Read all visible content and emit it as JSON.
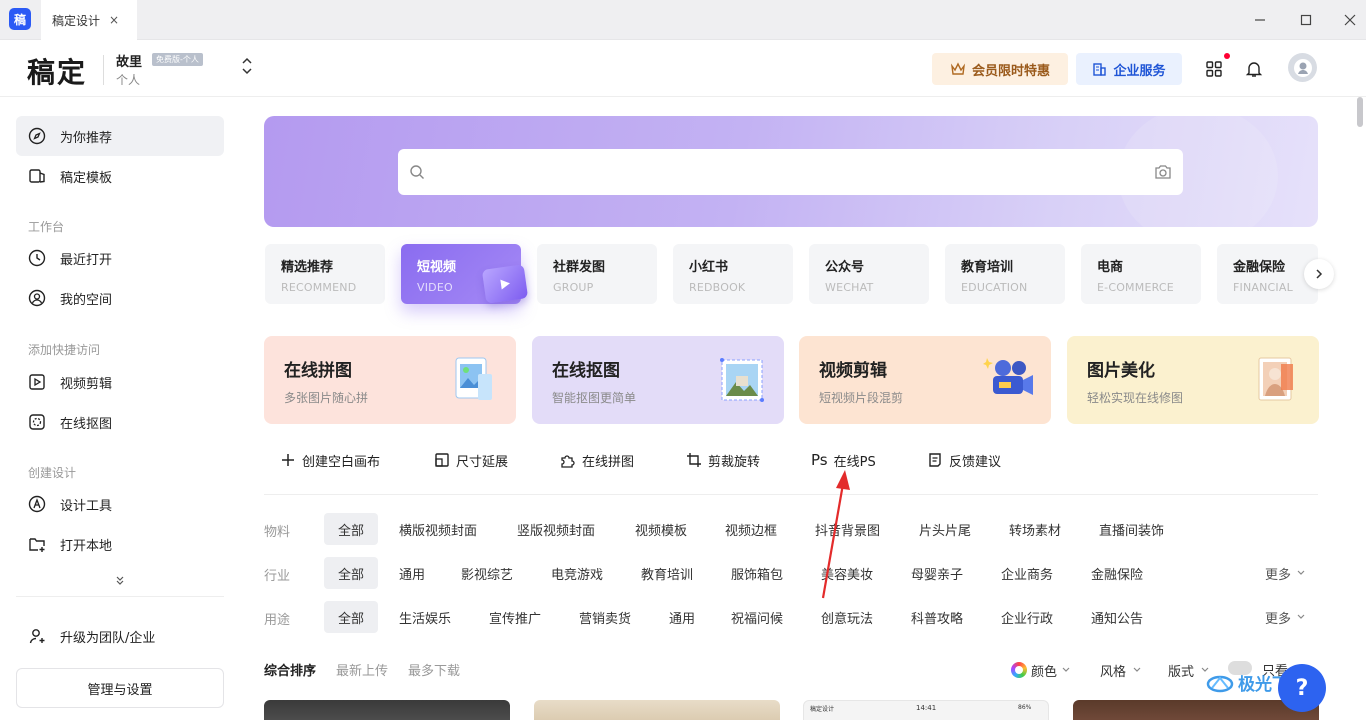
{
  "window": {
    "app_icon_text": "稿",
    "tab_title": "稿定设计",
    "tab_close": "×",
    "minimize": "—",
    "maximize": "☐",
    "close": "✕"
  },
  "header": {
    "logo": "稿定",
    "user_name": "故里",
    "user_badge": "免费版-个人",
    "user_sub": "个人",
    "vip_button": "会员限时特惠",
    "enterprise_button": "企业服务"
  },
  "sidebar": {
    "main_items": [
      {
        "label": "为你推荐",
        "icon": "compass-icon"
      },
      {
        "label": "稿定模板",
        "icon": "template-icon"
      }
    ],
    "workspace_title": "工作台",
    "workspace_items": [
      {
        "label": "最近打开",
        "icon": "clock-icon"
      },
      {
        "label": "我的空间",
        "icon": "user-circle-icon"
      }
    ],
    "quick_title": "添加快捷访问",
    "quick_items": [
      {
        "label": "视频剪辑",
        "icon": "play-square-icon"
      },
      {
        "label": "在线抠图",
        "icon": "cutout-icon"
      }
    ],
    "create_title": "创建设计",
    "create_items": [
      {
        "label": "设计工具",
        "icon": "pen-tool-icon"
      },
      {
        "label": "打开本地",
        "icon": "folder-plus-icon"
      }
    ],
    "upgrade": "升级为团队/企业",
    "manage": "管理与设置"
  },
  "search": {
    "placeholder": ""
  },
  "categories": [
    {
      "title": "精选推荐",
      "sub": "RECOMMEND"
    },
    {
      "title": "短视频",
      "sub": "VIDEO"
    },
    {
      "title": "社群发图",
      "sub": "GROUP"
    },
    {
      "title": "小红书",
      "sub": "REDBOOK"
    },
    {
      "title": "公众号",
      "sub": "WECHAT"
    },
    {
      "title": "教育培训",
      "sub": "EDUCATION"
    },
    {
      "title": "电商",
      "sub": "E-COMMERCE"
    },
    {
      "title": "金融保险",
      "sub": "FINANCIAL"
    }
  ],
  "feature_cards": [
    {
      "title": "在线拼图",
      "sub": "多张图片随心拼",
      "bg": "#fde3dc"
    },
    {
      "title": "在线抠图",
      "sub": "智能抠图更简单",
      "bg": "#e3dcf8"
    },
    {
      "title": "视频剪辑",
      "sub": "短视频片段混剪",
      "bg": "#fde4d2"
    },
    {
      "title": "图片美化",
      "sub": "轻松实现在线修图",
      "bg": "#fbf1cf"
    }
  ],
  "tools": [
    {
      "label": "创建空白画布",
      "icon": "plus-icon"
    },
    {
      "label": "尺寸延展",
      "icon": "resize-icon"
    },
    {
      "label": "在线拼图",
      "icon": "puzzle-icon"
    },
    {
      "label": "剪裁旋转",
      "icon": "crop-icon"
    },
    {
      "label": "在线PS",
      "icon": "ps-icon",
      "icon_text": "Ps"
    },
    {
      "label": "反馈建议",
      "icon": "feedback-icon"
    }
  ],
  "filters": {
    "material": {
      "label": "物料",
      "items": [
        "全部",
        "横版视频封面",
        "竖版视频封面",
        "视频模板",
        "视频边框",
        "抖音背景图",
        "片头片尾",
        "转场素材",
        "直播间装饰"
      ]
    },
    "industry": {
      "label": "行业",
      "items": [
        "全部",
        "通用",
        "影视综艺",
        "电竞游戏",
        "教育培训",
        "服饰箱包",
        "美容美妆",
        "母婴亲子",
        "企业商务",
        "金融保险"
      ],
      "more": "更多"
    },
    "usage": {
      "label": "用途",
      "items": [
        "全部",
        "生活娱乐",
        "宣传推广",
        "营销卖货",
        "通用",
        "祝福问候",
        "创意玩法",
        "科普攻略",
        "企业行政",
        "通知公告"
      ],
      "more": "更多"
    }
  },
  "sort": {
    "tabs": [
      "综合排序",
      "最新上传",
      "最多下载"
    ],
    "color": "颜色",
    "style": "风格",
    "layout": "版式",
    "partial": "只看"
  },
  "preview_text": {
    "phone_left": "稿定设计",
    "phone_time": "14:41",
    "phone_battery": "86%"
  },
  "help_button": "?",
  "watermark": "极光下载站"
}
